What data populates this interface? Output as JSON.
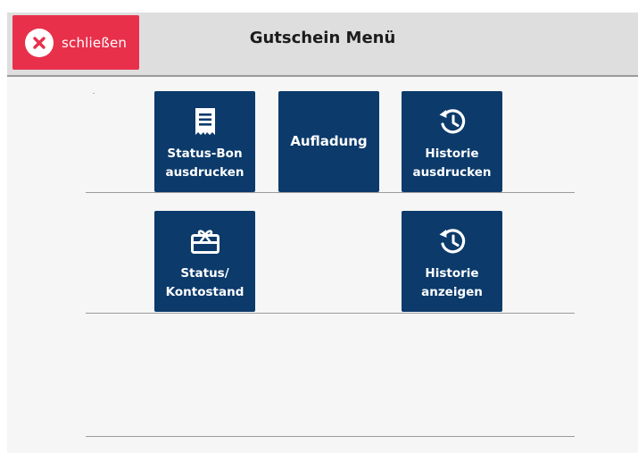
{
  "header": {
    "close_label": "schließen",
    "title": "Gutschein Menü"
  },
  "tiles": [
    {
      "icon": "receipt-icon",
      "line1": "Status-Bon",
      "line2": "ausdrucken"
    },
    {
      "icon": "",
      "label": "Aufladung"
    },
    {
      "icon": "history-icon",
      "line1": "Historie",
      "line2": "ausdrucken"
    },
    {
      "icon": "gift-card-icon",
      "line1": "Status/",
      "line2": "Kontostand"
    },
    {
      "icon": "history-icon",
      "line1": "Historie",
      "line2": "anzeigen"
    }
  ],
  "colors": {
    "header_bg": "#dedede",
    "close_button": "#e8304b",
    "tile": "#0b3a6b",
    "body_bg": "#f6f6f6"
  }
}
